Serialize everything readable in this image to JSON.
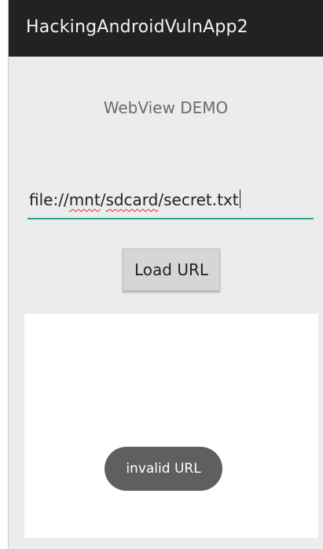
{
  "app": {
    "title": "HackingAndroidVulnApp2"
  },
  "screen": {
    "heading": "WebView DEMO"
  },
  "url_input": {
    "value_segments": [
      "file://",
      "mnt",
      "/",
      "sdcard",
      "/secret.txt"
    ]
  },
  "load_button": {
    "label": "Load URL"
  },
  "toast": {
    "message": "invalid URL"
  },
  "colors": {
    "action_bar": "#222222",
    "input_underline": "#2aa392",
    "spellcheck_underline": "#d62c2c",
    "toast_bg": "#5f5f5f"
  }
}
